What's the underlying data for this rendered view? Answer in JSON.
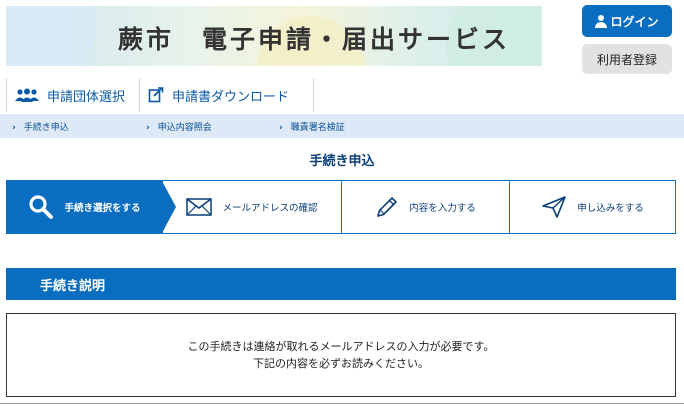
{
  "header": {
    "title": "蕨市　電子申請・届出サービス",
    "login_label": "ログイン",
    "register_label": "利用者登録"
  },
  "nav": {
    "tabs": [
      {
        "label": "申請団体選択",
        "icon": "group-icon"
      },
      {
        "label": "申請書ダウンロード",
        "icon": "download-form-icon"
      }
    ]
  },
  "subnav": {
    "items": [
      "手続き申込",
      "申込内容照会",
      "職責署名検証"
    ]
  },
  "page": {
    "title": "手続き申込"
  },
  "steps": [
    {
      "label": "手続き選択をする",
      "icon": "search-icon",
      "active": true
    },
    {
      "label": "メールアドレスの確認",
      "icon": "mail-icon",
      "active": false
    },
    {
      "label": "内容を入力する",
      "icon": "pencil-icon",
      "active": false
    },
    {
      "label": "申し込みをする",
      "icon": "send-icon",
      "active": false
    }
  ],
  "section": {
    "title": "手続き説明",
    "lines": [
      "この手続きは連絡が取れるメールアドレスの入力が必要です。",
      "下記の内容を必ずお読みください。"
    ]
  },
  "colors": {
    "primary": "#0a6ec0",
    "subnav_bg": "#dde9f7",
    "register_bg": "#e2e2e2"
  }
}
